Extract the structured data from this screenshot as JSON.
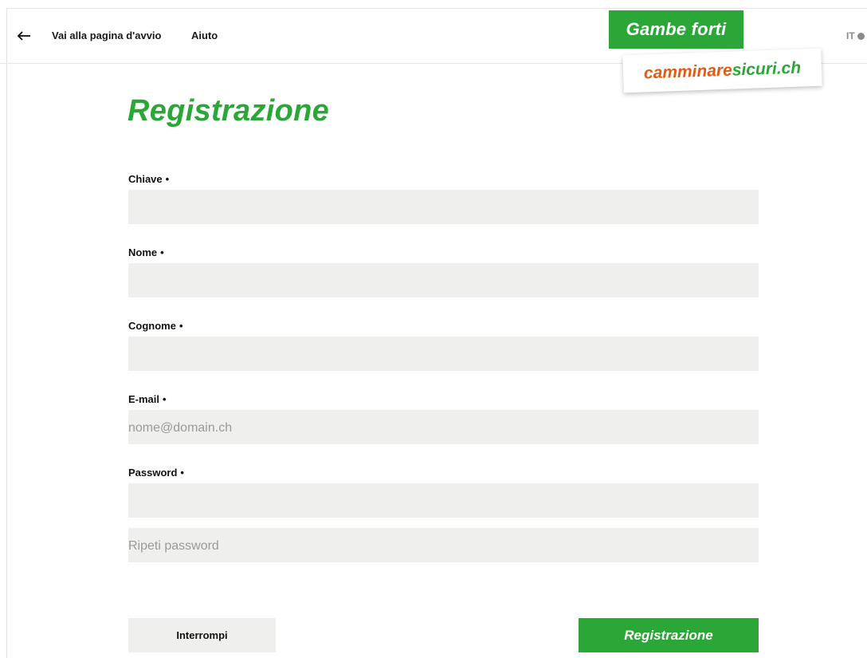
{
  "header": {
    "back_icon": "arrow-left-icon",
    "home_link": "Vai alla pagina d'avvio",
    "help_link": "Aiuto",
    "language": "IT",
    "language_icon": "globe-icon"
  },
  "logo": {
    "tagline": "Gambe forti",
    "site_part1": "camminare",
    "site_part2": "sicuri.ch"
  },
  "form": {
    "title": "Registrazione",
    "required_marker": "•",
    "fields": [
      {
        "label": "Chiave",
        "value": "",
        "placeholder": ""
      },
      {
        "label": "Nome",
        "value": "",
        "placeholder": ""
      },
      {
        "label": "Cognome",
        "value": "",
        "placeholder": ""
      },
      {
        "label": "E-mail",
        "value": "",
        "placeholder": "nome@domain.ch"
      },
      {
        "label": "Password",
        "value": "",
        "placeholder": ""
      }
    ],
    "repeat_password_placeholder": "Ripeti password",
    "cancel_label": "Interrompi",
    "submit_label": "Registrazione"
  },
  "colors": {
    "brand_green": "#2aa737",
    "brand_orange": "#e35b13",
    "field_bg": "#efefee"
  }
}
